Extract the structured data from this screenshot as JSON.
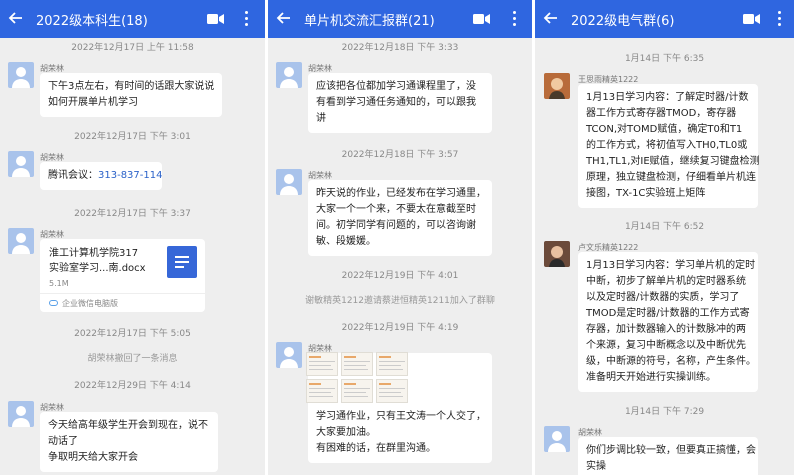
{
  "panel1": {
    "title": "2022级本科生(18)",
    "timestamps": [
      "2022年12月17日 上午 11:58",
      "2022年12月17日 下午 3:01",
      "2022年12月17日 下午 3:37",
      "2022年12月17日 下午 5:05",
      "2022年12月29日 下午 4:14"
    ],
    "sender": "胡荣林",
    "msg1": [
      "下午3点左右，有时间的话跟大家说说",
      "如何开展单片机学习"
    ],
    "msg2_prefix": "腾讯会议：",
    "msg2_link": "313-837-114",
    "file": {
      "name_line1": "淮工计算机学院317",
      "name_line2": "实验室学习...南.docx",
      "size": "5.1M",
      "source": "企业微信电脑版"
    },
    "recall": "胡荣林撤回了一条消息",
    "msg3": [
      "今天给高年级学生开会到现在，说不",
      "动话了",
      "争取明天给大家开会"
    ]
  },
  "panel2": {
    "title": "单片机交流汇报群(21)",
    "timestamps": [
      "2022年12月18日 下午 3:33",
      "2022年12月18日 下午 3:57",
      "2022年12月19日 下午 4:01",
      "2022年12月19日 下午 4:19"
    ],
    "sender": "胡荣林",
    "msg1": [
      "应该把各位都加学习通课程里了，没",
      "有看到学习通任务通知的，可以跟我",
      "讲"
    ],
    "msg2": [
      "昨天说的作业，已经发布在学习通里，",
      "大家一个一个来，不要太在意截至时",
      "间。初学同学有问题的，可以咨询谢",
      "敏、段媛媛。"
    ],
    "system": "谢敏精英1212邀请蔡进恒精英1211加入了群聊",
    "msg3": [
      "学习通作业，只有王文涛一个人交了，",
      "大家要加油。",
      "有困难的话，在群里沟通。"
    ]
  },
  "panel3": {
    "title": "2022级电气群(6)",
    "timestamps": [
      "1月14日 下午 6:35",
      "1月14日 下午 6:52",
      "1月14日 下午 7:29"
    ],
    "sender1": "王思雨精英1222",
    "msg1": [
      "1月13日学习内容：了解定时器/计数",
      "器工作方式寄存器TMOD，寄存器",
      "TCON,对TOMD赋值，确定T0和T1",
      "的工作方式，将初值写入TH0,TL0或",
      "TH1,TL1,对IE赋值，继续复习键盘检测",
      "原理，独立键盘检测，仔细看单片机连",
      "接图，TX-1C实验班上矩阵"
    ],
    "sender2": "卢文乐精英1222",
    "msg2": [
      "1月13日学习内容：学习单片机的定时",
      "中断，初步了解单片机的定时器系统",
      "以及定时器/计数器的实质，学习了",
      "TMOD是定时器/计数器的工作方式寄",
      "存器，加计数器输入的计数脉冲的两",
      "个来源，复习中断概念以及中断优先",
      "级，中断源的符号，名称，产生条件。",
      "准备明天开始进行实操训练。"
    ],
    "sender3": "胡荣林",
    "msg3": [
      "你们步调比较一致，但要真正搞懂，会",
      "实操"
    ]
  },
  "colors": {
    "header": "#2f66e0",
    "link": "#2b62c9",
    "chat_bg": "#eeeeee"
  }
}
